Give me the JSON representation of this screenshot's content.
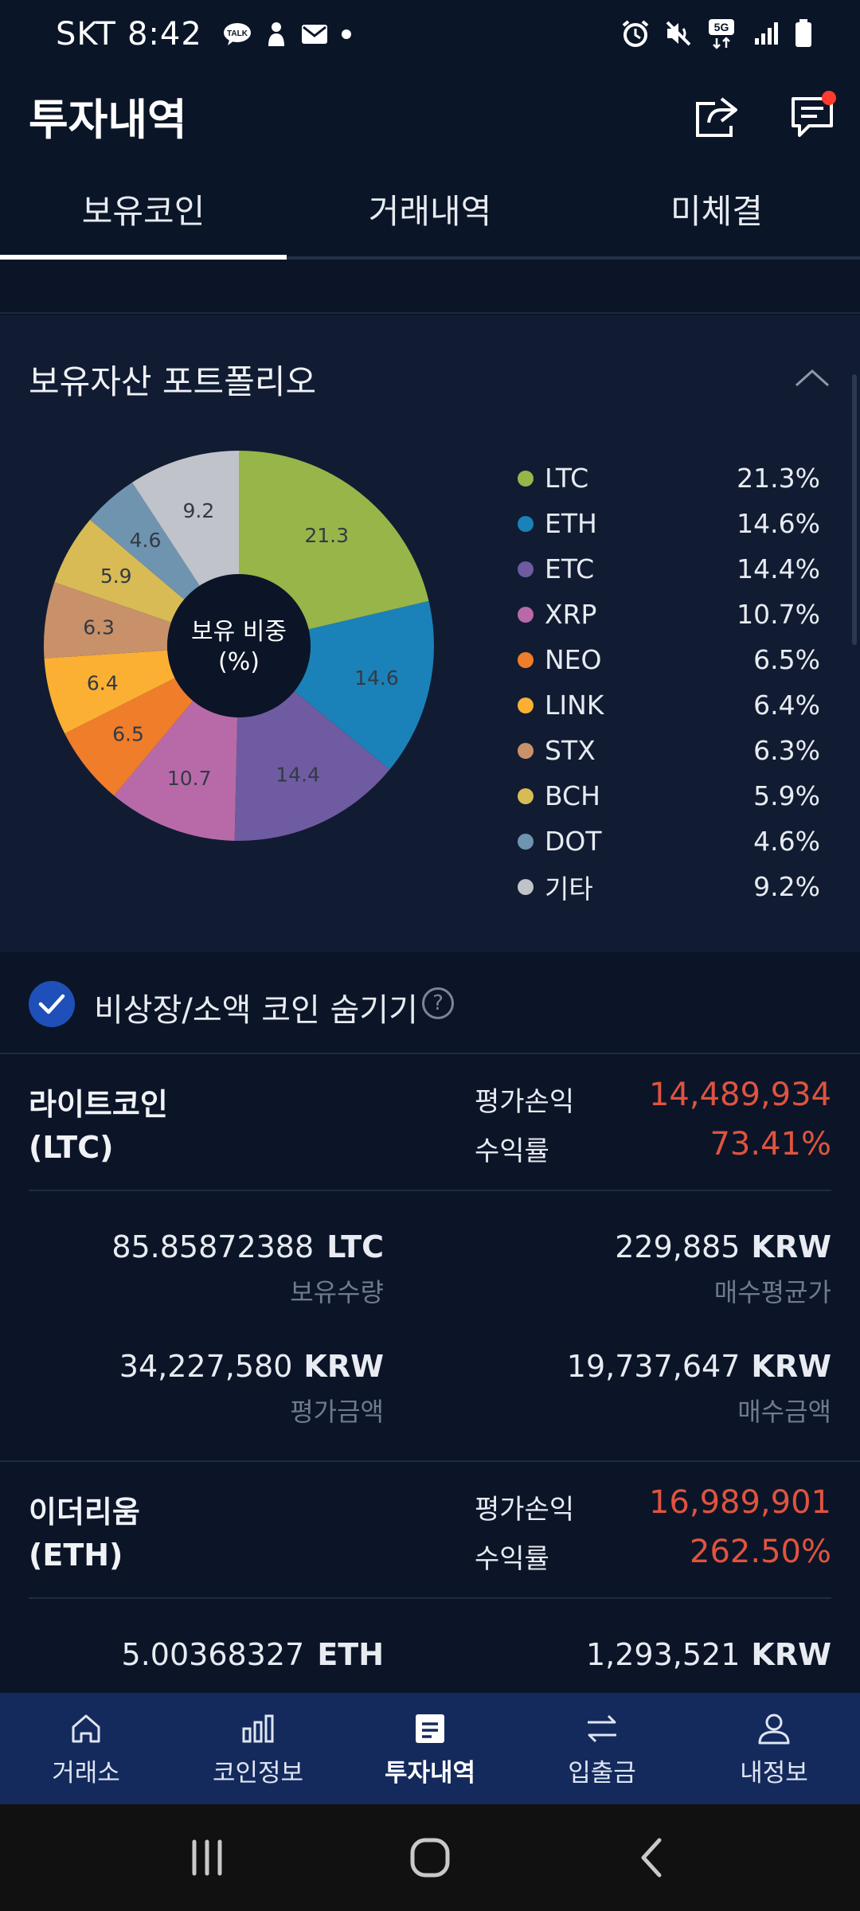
{
  "status_bar": {
    "carrier": "SKT",
    "time": "8:42",
    "network": "5G"
  },
  "header": {
    "title": "투자내역"
  },
  "tabs": [
    {
      "label": "보유코인",
      "active": true
    },
    {
      "label": "거래내역",
      "active": false
    },
    {
      "label": "미체결",
      "active": false
    }
  ],
  "portfolio": {
    "title": "보유자산 포트폴리오",
    "center_label_line1": "보유 비중",
    "center_label_line2": "(%)",
    "legend": [
      {
        "name": "LTC",
        "value": "21.3%"
      },
      {
        "name": "ETH",
        "value": "14.6%"
      },
      {
        "name": "ETC",
        "value": "14.4%"
      },
      {
        "name": "XRP",
        "value": "10.7%"
      },
      {
        "name": "NEO",
        "value": "6.5%"
      },
      {
        "name": "LINK",
        "value": "6.4%"
      },
      {
        "name": "STX",
        "value": "6.3%"
      },
      {
        "name": "BCH",
        "value": "5.9%"
      },
      {
        "name": "DOT",
        "value": "4.6%"
      },
      {
        "name": "기타",
        "value": "9.2%"
      }
    ]
  },
  "chart_data": {
    "type": "pie",
    "title": "보유 비중 (%)",
    "categories": [
      "LTC",
      "ETH",
      "ETC",
      "XRP",
      "NEO",
      "LINK",
      "STX",
      "BCH",
      "DOT",
      "기타"
    ],
    "values": [
      21.3,
      14.6,
      14.4,
      10.7,
      6.5,
      6.4,
      6.3,
      5.9,
      4.6,
      9.2
    ],
    "colors": [
      "#98b54a",
      "#1a82b8",
      "#6e5ba1",
      "#b86aa8",
      "#f07d2a",
      "#fbb034",
      "#c8916a",
      "#d8bb55",
      "#6f94b0",
      "#c0c3c9"
    ],
    "donut": true,
    "legend": "right"
  },
  "hide_toggle": {
    "label": "비상장/소액 코인 숨기기",
    "help": "?",
    "checked": true
  },
  "labels": {
    "pl": "평가손익",
    "rate": "수익률",
    "holding": "보유수량",
    "avg_price": "매수평균가",
    "eval_amount": "평가금액",
    "buy_amount": "매수금액",
    "krw": "KRW"
  },
  "coins": [
    {
      "name_line1": "라이트코인",
      "name_line2": "(LTC)",
      "pl": "14,489,934",
      "rate": "73.41%",
      "holding": "85.85872388",
      "symbol": "LTC",
      "avg_price": "229,885",
      "eval_amount": "34,227,580",
      "buy_amount": "19,737,647"
    },
    {
      "name_line1": "이더리움",
      "name_line2": "(ETH)",
      "pl": "16,989,901",
      "rate": "262.50%",
      "holding": "5.00368327",
      "symbol": "ETH",
      "avg_price": "1,293,521"
    }
  ],
  "bottom_nav": [
    {
      "label": "거래소",
      "icon": "home-icon"
    },
    {
      "label": "코인정보",
      "icon": "bar-chart-icon"
    },
    {
      "label": "투자내역",
      "icon": "document-icon",
      "active": true
    },
    {
      "label": "입출금",
      "icon": "transfer-icon"
    },
    {
      "label": "내정보",
      "icon": "person-icon"
    }
  ],
  "colors": {
    "background": "#0b1527",
    "card": "#111c33",
    "accent": "#1f4fb8",
    "profit": "#e0533f",
    "nav": "#142a5c"
  }
}
